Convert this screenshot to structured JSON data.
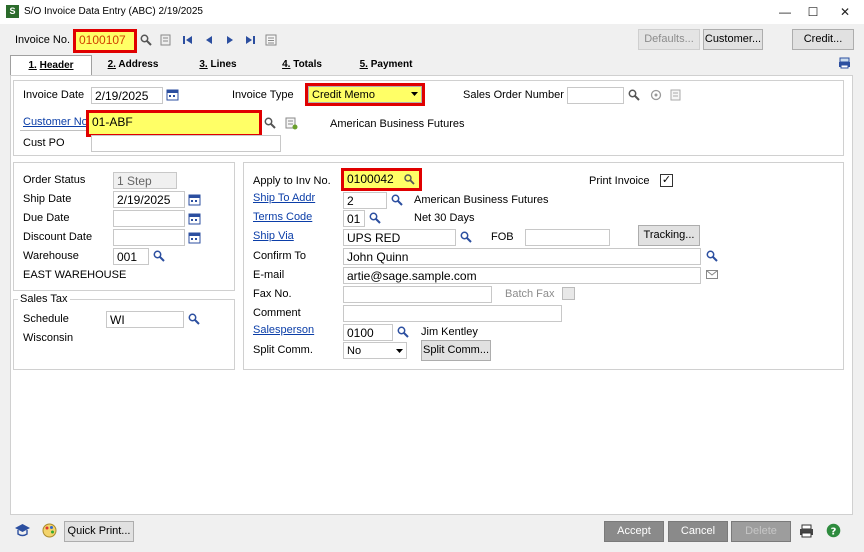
{
  "window": {
    "title": "S/O Invoice Data Entry (ABC) 2/19/2025",
    "app_icon_letter": "S",
    "controls": {
      "minimize": "—",
      "maximize": "☐",
      "close": "✕"
    }
  },
  "toolbar": {
    "invoice_no_label": "Invoice No.",
    "invoice_no_value": "0100107",
    "defaults_label": "Defaults...",
    "customer_label": "Customer...",
    "credit_label": "Credit..."
  },
  "tabs": [
    {
      "num": "1.",
      "label": "Header"
    },
    {
      "num": "2.",
      "label": "Address"
    },
    {
      "num": "3.",
      "label": "Lines"
    },
    {
      "num": "4.",
      "label": "Totals"
    },
    {
      "num": "5.",
      "label": "Payment"
    }
  ],
  "header": {
    "invoice_date_label": "Invoice Date",
    "invoice_date_value": "2/19/2025",
    "invoice_type_label": "Invoice Type",
    "invoice_type_value": "Credit Memo",
    "sales_order_label": "Sales Order Number",
    "sales_order_value": "",
    "customer_no_label": "Customer No.",
    "customer_no_value": "01-ABF",
    "customer_name": "American Business Futures",
    "cust_po_label": "Cust PO",
    "cust_po_value": ""
  },
  "left_panel": {
    "order_status_label": "Order Status",
    "order_status_value": "1 Step",
    "ship_date_label": "Ship Date",
    "ship_date_value": "2/19/2025",
    "due_date_label": "Due Date",
    "due_date_value": "",
    "discount_date_label": "Discount Date",
    "discount_date_value": "",
    "warehouse_label": "Warehouse",
    "warehouse_value": "001",
    "warehouse_name": "EAST WAREHOUSE"
  },
  "sales_tax": {
    "group_label": "Sales Tax",
    "schedule_label": "Schedule",
    "schedule_value": "WI",
    "schedule_name": "Wisconsin"
  },
  "right_panel": {
    "apply_to_label": "Apply to Inv No.",
    "apply_to_value": "0100042",
    "print_invoice_label": "Print Invoice",
    "print_invoice_checked": "✓",
    "ship_to_label": "Ship To Addr",
    "ship_to_value": "2",
    "ship_to_name": "American Business Futures",
    "terms_label": "Terms Code",
    "terms_value": "01",
    "terms_desc": "Net 30 Days",
    "ship_via_label": "Ship Via",
    "ship_via_value": "UPS RED",
    "fob_label": "FOB",
    "fob_value": "",
    "tracking_label": "Tracking...",
    "confirm_label": "Confirm To",
    "confirm_value": "John Quinn",
    "email_label": "E-mail",
    "email_value": "artie@sage.sample.com",
    "fax_label": "Fax No.",
    "fax_value": "",
    "batch_fax_label": "Batch Fax",
    "comment_label": "Comment",
    "comment_value": "",
    "salesperson_label": "Salesperson",
    "salesperson_value": "0100",
    "salesperson_name": "Jim Kentley",
    "split_label": "Split Comm.",
    "split_value": "No",
    "split_btn_label": "Split Comm..."
  },
  "footer": {
    "quick_print_label": "Quick Print...",
    "accept_label": "Accept",
    "cancel_label": "Cancel",
    "delete_label": "Delete"
  },
  "colors": {
    "highlight": "#ffff66",
    "callout": "#e00000",
    "link": "#0b3ea8"
  }
}
